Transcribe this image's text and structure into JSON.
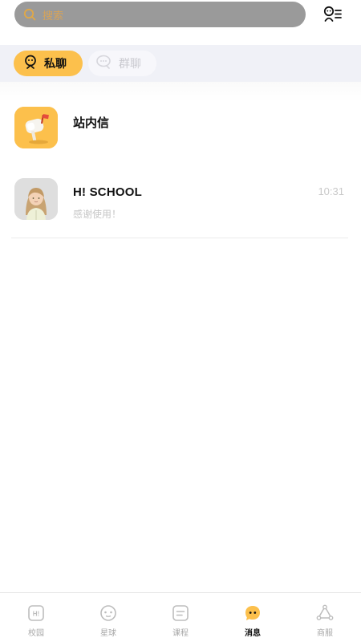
{
  "search": {
    "placeholder": "搜索"
  },
  "tabs": [
    {
      "label": "私聊",
      "active": true
    },
    {
      "label": "群聊",
      "active": false
    }
  ],
  "conversations": [
    {
      "title": "站内信",
      "preview": "",
      "time": ""
    },
    {
      "title": "H! SCHOOL",
      "preview": "感谢使用！",
      "time": "10:31"
    }
  ],
  "bottom_nav": [
    {
      "label": "校园",
      "icon": "campus-icon",
      "active": false
    },
    {
      "label": "星球",
      "icon": "planet-icon",
      "active": false
    },
    {
      "label": "课程",
      "icon": "course-icon",
      "active": false
    },
    {
      "label": "消息",
      "icon": "message-icon",
      "active": true
    },
    {
      "label": "商服",
      "icon": "commerce-icon",
      "active": false
    }
  ],
  "colors": {
    "accent": "#fcc04c",
    "search_bg": "#9a9a9a",
    "tabs_strip_bg": "#f0f1f7",
    "muted_text": "#c6c6c6"
  }
}
